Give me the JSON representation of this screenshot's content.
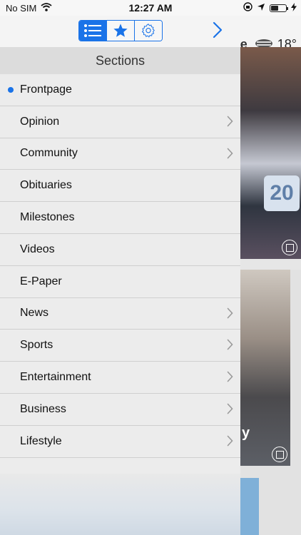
{
  "status_bar": {
    "carrier": "No SIM",
    "time": "12:27 AM"
  },
  "background": {
    "title_tail": "e",
    "temperature": "18°",
    "photo1_jersey": "20",
    "photo2_caption_tail": "y"
  },
  "toolbar": {
    "segments": [
      {
        "icon": "list-icon",
        "active": true
      },
      {
        "icon": "star-icon",
        "active": false
      },
      {
        "icon": "gear-icon",
        "active": false
      }
    ],
    "accent": "#1a73e8"
  },
  "sections": {
    "header": "Sections",
    "items": [
      {
        "label": "Frontpage",
        "selected": true,
        "has_chevron": false
      },
      {
        "label": "Opinion",
        "selected": false,
        "has_chevron": true
      },
      {
        "label": "Community",
        "selected": false,
        "has_chevron": true
      },
      {
        "label": "Obituaries",
        "selected": false,
        "has_chevron": false
      },
      {
        "label": "Milestones",
        "selected": false,
        "has_chevron": false
      },
      {
        "label": "Videos",
        "selected": false,
        "has_chevron": false
      },
      {
        "label": "E-Paper",
        "selected": false,
        "has_chevron": false
      },
      {
        "label": "News",
        "selected": false,
        "has_chevron": true
      },
      {
        "label": "Sports",
        "selected": false,
        "has_chevron": true
      },
      {
        "label": "Entertainment",
        "selected": false,
        "has_chevron": true
      },
      {
        "label": "Business",
        "selected": false,
        "has_chevron": true
      },
      {
        "label": "Lifestyle",
        "selected": false,
        "has_chevron": true
      }
    ]
  }
}
